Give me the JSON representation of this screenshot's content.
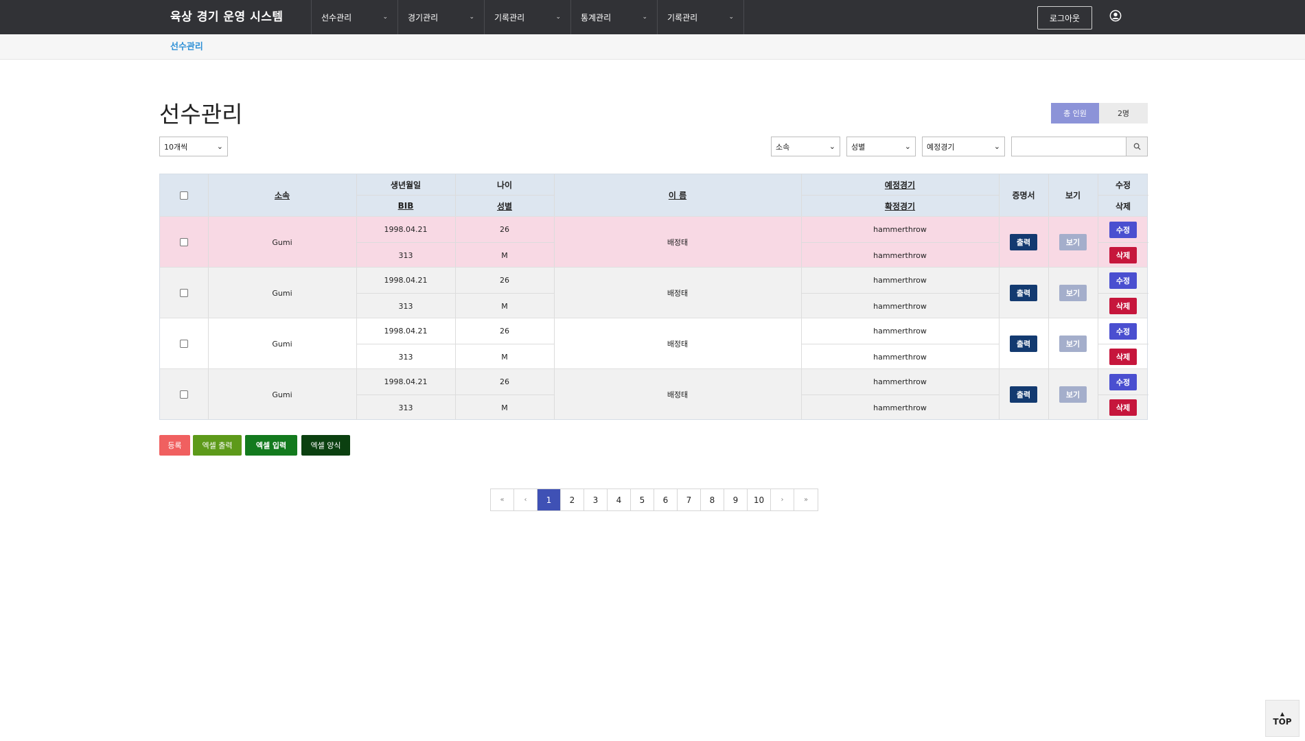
{
  "app": {
    "title": "육상 경기 운영 시스템"
  },
  "nav": {
    "items": [
      {
        "label": "선수관리"
      },
      {
        "label": "경기관리"
      },
      {
        "label": "기록관리"
      },
      {
        "label": "통계관리"
      },
      {
        "label": "기록관리"
      }
    ],
    "logout_label": "로그아웃",
    "chevron": "⌄"
  },
  "breadcrumb": {
    "current": "선수관리"
  },
  "page": {
    "title": "선수관리",
    "count_label": "총 인원",
    "count_value": "2명"
  },
  "filters": {
    "page_size": "10개씩",
    "affiliation": "소속",
    "gender": "성별",
    "scheduled_event": "예정경기",
    "search_value": ""
  },
  "table": {
    "headers": {
      "affiliation": "소속",
      "birthdate": "생년월일",
      "bib": "BIB",
      "age": "나이",
      "gender": "성별",
      "name": "이 름",
      "scheduled_event": "예정경기",
      "confirmed_event": "확정경기",
      "certificate": "증명서",
      "view": "보기",
      "edit": "수정",
      "delete": "삭제"
    },
    "rows": [
      {
        "affiliation": "Gumi",
        "birthdate": "1998.04.21",
        "bib": "313",
        "age": "26",
        "gender": "M",
        "name": "배정태",
        "scheduled_event": "hammerthrow",
        "confirmed_event": "hammerthrow",
        "print_label": "출력",
        "view_label": "보기",
        "edit_label": "수정",
        "delete_label": "삭제"
      },
      {
        "affiliation": "Gumi",
        "birthdate": "1998.04.21",
        "bib": "313",
        "age": "26",
        "gender": "M",
        "name": "배정태",
        "scheduled_event": "hammerthrow",
        "confirmed_event": "hammerthrow",
        "print_label": "출력",
        "view_label": "보기",
        "edit_label": "수정",
        "delete_label": "삭제"
      },
      {
        "affiliation": "Gumi",
        "birthdate": "1998.04.21",
        "bib": "313",
        "age": "26",
        "gender": "M",
        "name": "배정태",
        "scheduled_event": "hammerthrow",
        "confirmed_event": "hammerthrow",
        "print_label": "출력",
        "view_label": "보기",
        "edit_label": "수정",
        "delete_label": "삭제"
      },
      {
        "affiliation": "Gumi",
        "birthdate": "1998.04.21",
        "bib": "313",
        "age": "26",
        "gender": "M",
        "name": "배정태",
        "scheduled_event": "hammerthrow",
        "confirmed_event": "hammerthrow",
        "print_label": "출력",
        "view_label": "보기",
        "edit_label": "수정",
        "delete_label": "삭제"
      }
    ]
  },
  "actions": {
    "register": "등록",
    "excel_export": "엑셀 출력",
    "excel_import": "엑셀 입력",
    "excel_template": "엑셀 양식"
  },
  "pagination": {
    "first": "«",
    "prev": "‹",
    "pages": [
      "1",
      "2",
      "3",
      "4",
      "5",
      "6",
      "7",
      "8",
      "9",
      "10"
    ],
    "active_page": "1",
    "next": "›",
    "last": "»"
  },
  "top_button": {
    "arrow": "▲",
    "label": "TOP"
  },
  "colors": {
    "nav_bg": "#313236",
    "breadcrumb": "#2e90d6",
    "count_label_bg": "#8c93d8",
    "header_bg": "#dde6f0",
    "highlight_row": "#f8d9e4",
    "print_button": "#133a70",
    "view_button": "#a4aecb",
    "edit_button": "#4a4fd0",
    "delete_button": "#c6163c",
    "register_button": "#f06060",
    "excel_export_button": "#5d9a1a",
    "excel_import_button": "#137a1e",
    "excel_template_button": "#0b4010",
    "active_page": "#3f51b5"
  }
}
